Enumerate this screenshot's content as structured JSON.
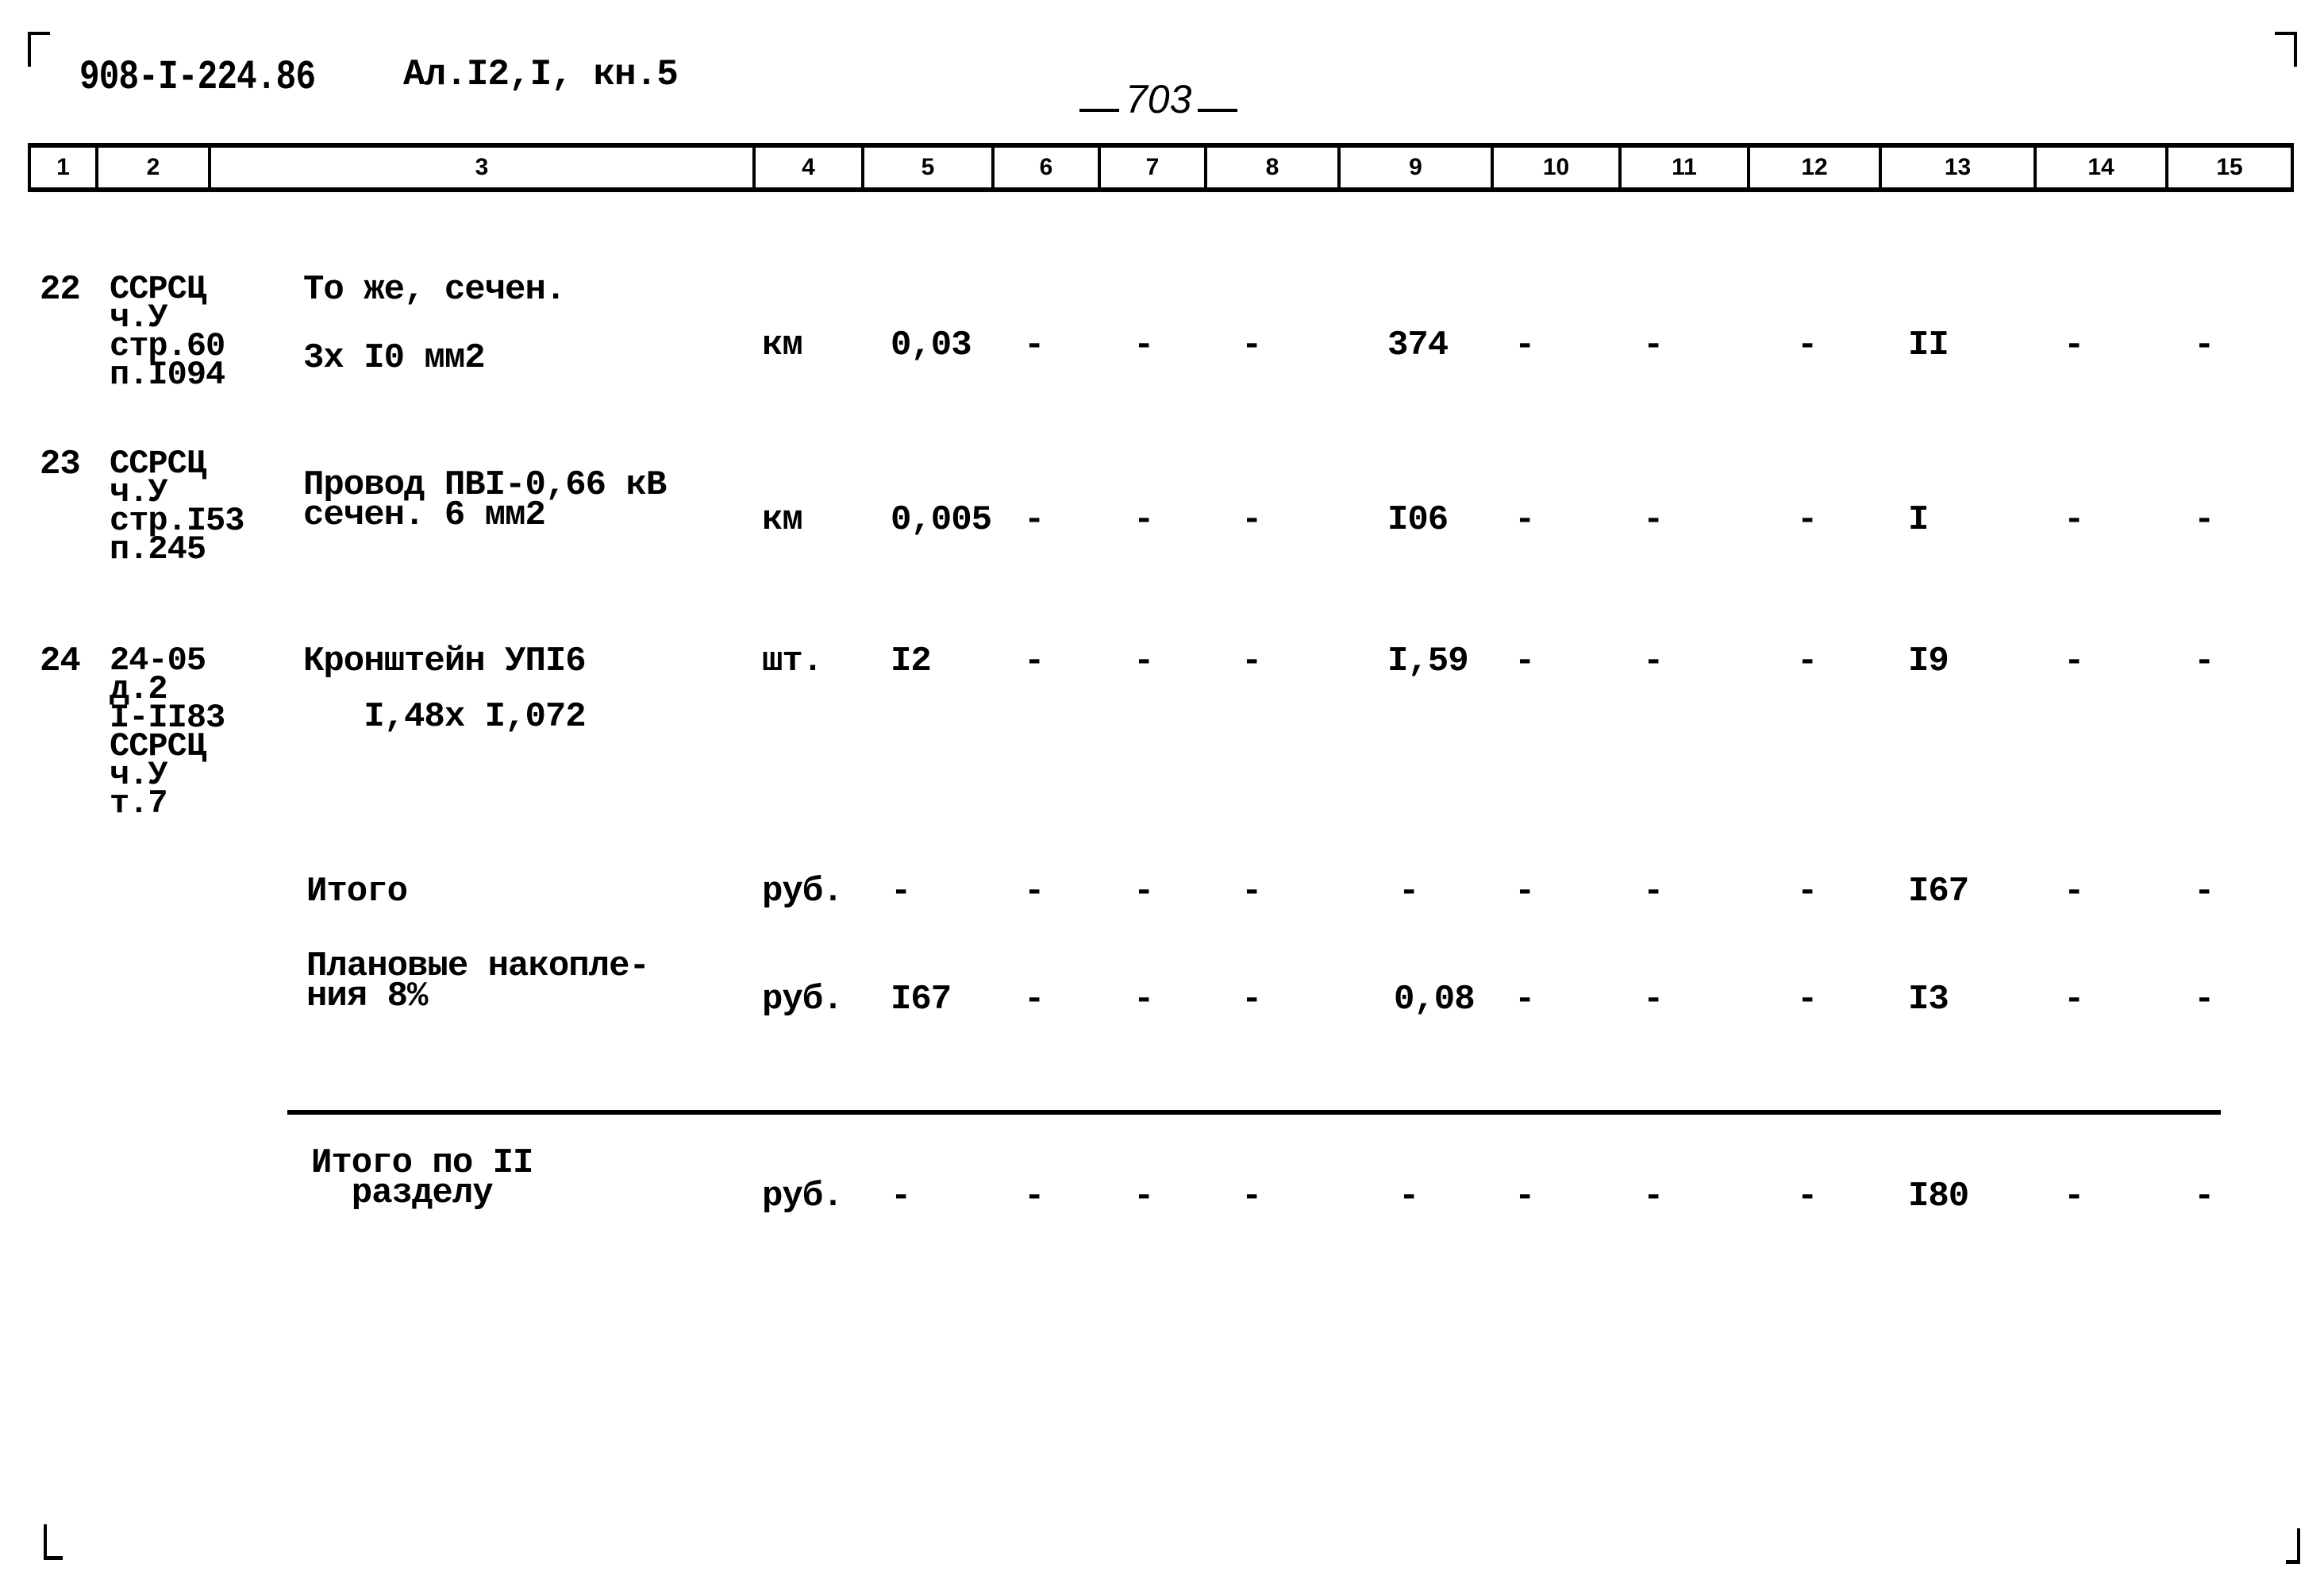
{
  "header": {
    "doc_code": "908-I-224.86",
    "doc_ref": "Ал.I2,I, кн.5",
    "page_number": "703"
  },
  "columns": [
    "1",
    "2",
    "3",
    "4",
    "5",
    "6",
    "7",
    "8",
    "9",
    "10",
    "11",
    "12",
    "13",
    "14",
    "15"
  ],
  "rows": [
    {
      "num": "22",
      "source": "ССРСЦ\nч.У\nстр.60\nп.I094",
      "name": "То же, сечен.\n3х I0 мм2",
      "unit": "км",
      "c5": "0,03",
      "c6": "-",
      "c7": "-",
      "c8": "-",
      "c9": "374",
      "c10": "-",
      "c11": "-",
      "c12": "-",
      "c13": "II",
      "c14": "-",
      "c15": "-"
    },
    {
      "num": "23",
      "source": "ССРСЦ\nч.У\nстр.I53\nп.245",
      "name": "Провод ПВI-0,66 кВ\nсечен. 6 мм2",
      "unit": "км",
      "c5": "0,005",
      "c6": "-",
      "c7": "-",
      "c8": "-",
      "c9": "I06",
      "c10": "-",
      "c11": "-",
      "c12": "-",
      "c13": "I",
      "c14": "-",
      "c15": "-"
    },
    {
      "num": "24",
      "source": "24-05\nд.2\nI-II83\nССРСЦ\nч.У\nт.7",
      "name": "Кронштейн УПI6\n   I,48х I,072",
      "unit": "шт.",
      "c5": "I2",
      "c6": "-",
      "c7": "-",
      "c8": "-",
      "c9": "I,59",
      "c10": "-",
      "c11": "-",
      "c12": "-",
      "c13": "I9",
      "c14": "-",
      "c15": "-"
    }
  ],
  "subtotal": {
    "name": "Итого",
    "unit": "руб.",
    "c5": "-",
    "c6": "-",
    "c7": "-",
    "c8": "-",
    "c9": "-",
    "c10": "-",
    "c11": "-",
    "c12": "-",
    "c13": "I67",
    "c14": "-",
    "c15": "-"
  },
  "planned_savings": {
    "name": "Плановые накопле-\nния 8%",
    "unit": "руб.",
    "c5": "I67",
    "c6": "-",
    "c7": "-",
    "c8": "-",
    "c9": "0,08",
    "c10": "-",
    "c11": "-",
    "c12": "-",
    "c13": "I3",
    "c14": "-",
    "c15": "-"
  },
  "section_total": {
    "name": "Итого по II\n  разделу",
    "unit": "руб.",
    "c5": "-",
    "c6": "-",
    "c7": "-",
    "c8": "-",
    "c9": "-",
    "c10": "-",
    "c11": "-",
    "c12": "-",
    "c13": "I80",
    "c14": "-",
    "c15": "-"
  }
}
